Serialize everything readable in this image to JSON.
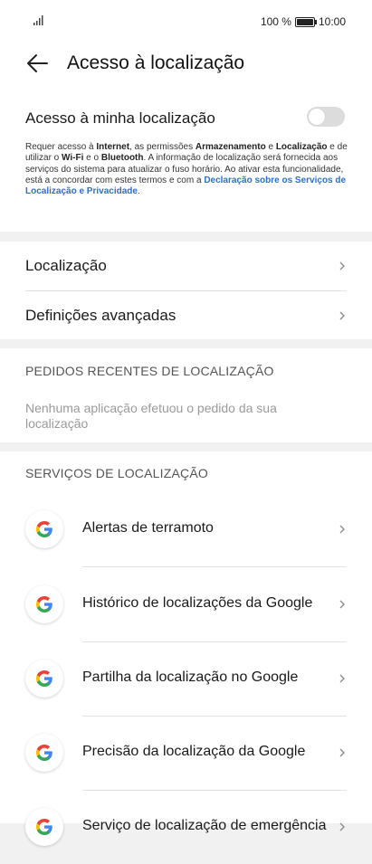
{
  "status_bar": {
    "battery": "100 %",
    "time": "10:00"
  },
  "header": {
    "title": "Acesso à localização"
  },
  "access": {
    "label": "Acesso à minha localização",
    "enabled": false,
    "desc": {
      "t1": "Requer acesso à ",
      "b1": "Internet",
      "t2": ", as permissões ",
      "b2": "Armazenamento",
      "t3": " e ",
      "b3": "Localização",
      "t4": " e de utilizar o ",
      "b4": "Wi-Fi",
      "t5": " e o ",
      "b5": "Bluetooth",
      "t6": ". A informação de localização será fornecida aos serviços do sistema para atualizar o fuso horário. Ao ativar esta funcionalidade, está a concordar com estes termos e com a ",
      "link": "Declaração sobre os Serviços de Localização e Privacidade",
      "t7": "."
    }
  },
  "nav": {
    "location": "Localização",
    "advanced": "Definições avançadas"
  },
  "recent": {
    "title": "PEDIDOS RECENTES DE LOCALIZAÇÃO",
    "empty": "Nenhuma aplicação efetuou o pedido da sua localização"
  },
  "services": {
    "title": "SERVIÇOS DE LOCALIZAÇÃO",
    "items": [
      {
        "label": "Alertas de terramoto"
      },
      {
        "label": "Histórico de localizações da Google"
      },
      {
        "label": "Partilha da localização no Google"
      },
      {
        "label": "Precisão da localização da Google"
      },
      {
        "label": "Serviço de localização de emergência"
      }
    ]
  },
  "colors": {
    "accent": "#2a6fd6",
    "background": "#f1f1f1"
  }
}
